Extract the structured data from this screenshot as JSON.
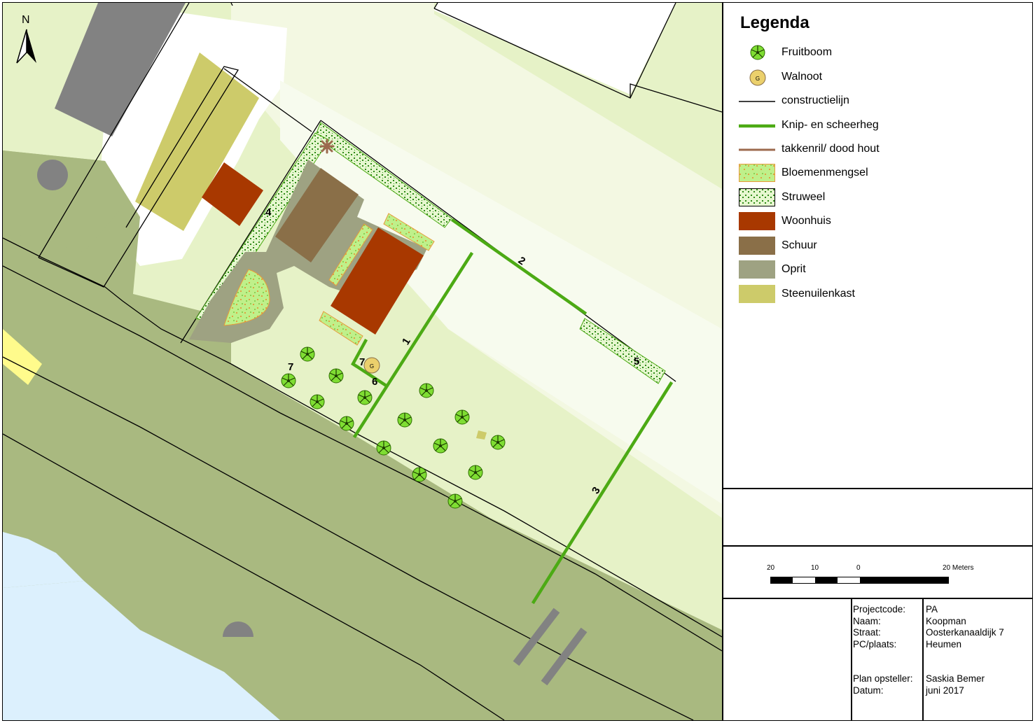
{
  "map": {
    "north_label": "N",
    "zone_labels": [
      "1",
      "2",
      "3",
      "4",
      "5",
      "6",
      "7",
      "7"
    ],
    "walnut_letter": "G",
    "colors": {
      "background_pale": "#e6f2c7",
      "grass_dark": "#a9b980",
      "water": "#dcf0fd",
      "road": "#828282",
      "hedge": "#4caa14",
      "woonhuis": "#a83800",
      "schuur": "#8a6f48",
      "oprit": "#9ea282",
      "steenuilenkast": "#cdcb6a",
      "yellow_road": "#fffb8c"
    }
  },
  "legend": {
    "title": "Legenda",
    "items": [
      {
        "label": "Fruitboom",
        "symbol": "tree-icon"
      },
      {
        "label": "Walnoot",
        "symbol": "walnut-icon"
      },
      {
        "label": "constructielijn",
        "symbol": "black-line"
      },
      {
        "label": "Knip- en scheerheg",
        "symbol": "green-line"
      },
      {
        "label": "takkenril/ dood hout",
        "symbol": "brown-line"
      },
      {
        "label": "Bloemenmengsel",
        "symbol": "flower-fill"
      },
      {
        "label": "Struweel",
        "symbol": "shrub-fill"
      },
      {
        "label": "Woonhuis",
        "symbol": "#a83800"
      },
      {
        "label": "Schuur",
        "symbol": "#8a6f48"
      },
      {
        "label": "Oprit",
        "symbol": "#9ea282"
      },
      {
        "label": "Steenuilenkast",
        "symbol": "#cdcb6a"
      }
    ]
  },
  "scale": {
    "labels": [
      "20",
      "10",
      "0",
      "20 Meters"
    ]
  },
  "info": {
    "keys": [
      "Projectcode:",
      "Naam:",
      "Straat:",
      "PC/plaats:",
      "Plan opsteller:",
      "Datum:"
    ],
    "values": [
      "PA",
      "Koopman",
      "Oosterkanaaldijk 7",
      "Heumen",
      "Saskia Bemer",
      "juni 2017"
    ]
  }
}
